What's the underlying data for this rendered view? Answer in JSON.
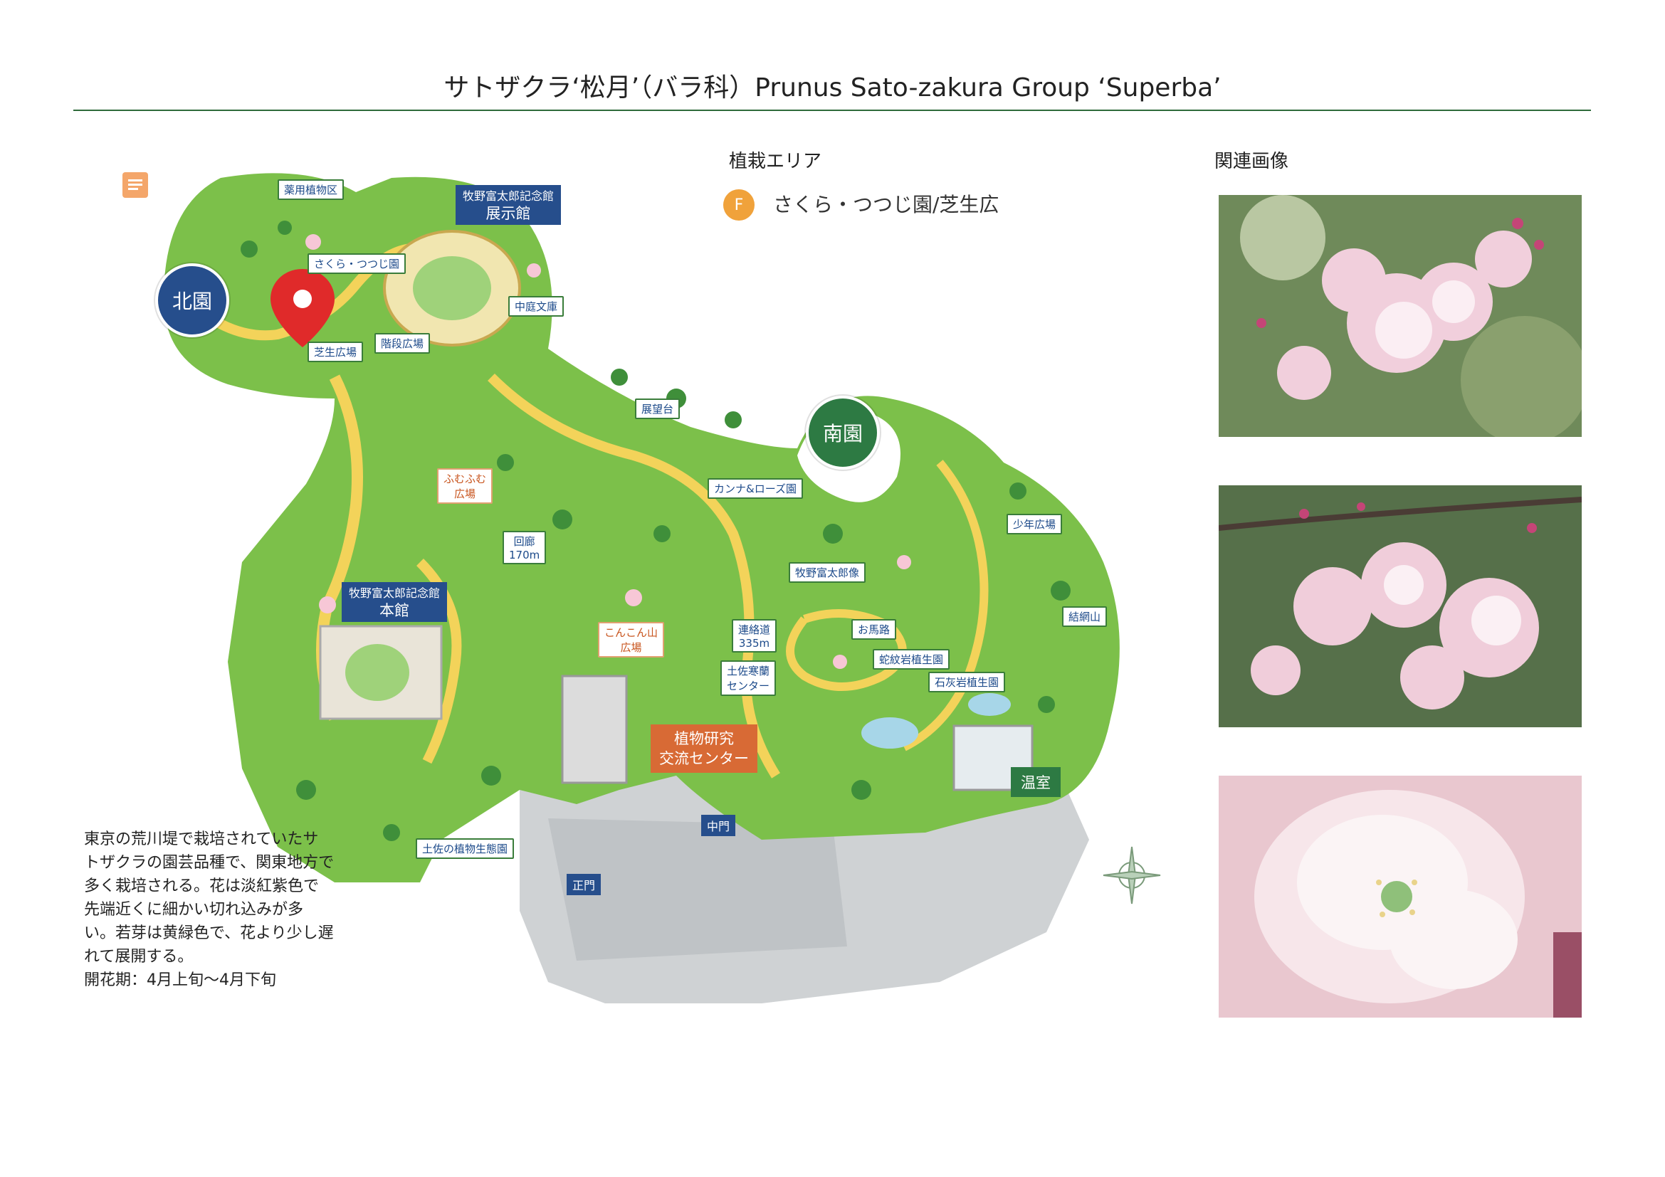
{
  "title": "サトザクラ‘松月’（バラ科）Prunus Sato-zakura Group ‘Superba’",
  "planting": {
    "heading": "植栽エリア",
    "badge_letter": "F",
    "area_name": "さくら・つつじ園/芝生広"
  },
  "photos": {
    "heading": "関連画像"
  },
  "description": {
    "lines": [
      "東京の荒川堤で栽培されていたサ",
      "トザクラの園芸品種で、関東地方で",
      "多く栽培される。花は淡紅紫色で",
      "先端近くに細かい切れ込みが多",
      "い。若芽は黄緑色で、花より少し遅",
      "れて展開する。",
      "開花期：4月上旬〜4月下旬"
    ]
  },
  "map": {
    "zones": {
      "north": "北園",
      "south": "南園"
    },
    "buildings": {
      "exhibit_line1": "牧野富太郎記念館",
      "exhibit_line2": "展示館",
      "main_line1": "牧野富太郎記念館",
      "main_line2": "本館",
      "research_line1": "植物研究",
      "research_line2": "交流センター",
      "greenhouse": "温室"
    },
    "gates": {
      "main": "正門",
      "middle": "中門"
    },
    "labels": {
      "medicinal": "薬用植物区",
      "sakura": "さくら・つつじ園",
      "lawn": "芝生広場",
      "stairs": "階段広場",
      "courtyard": "中庭文庫",
      "observatory": "展望台",
      "canna": "カンナ&ローズ園",
      "fumufumu_1": "ふむふむ",
      "fumufumu_2": "広場",
      "corridor_1": "回廊",
      "corridor_2": "170m",
      "konkon_1": "こんこん山",
      "konkon_2": "広場",
      "renraku_1": "連絡道",
      "renraku_2": "335m",
      "tosa_kanran_1": "土佐寒蘭",
      "tosa_kanran_2": "センター",
      "makino_statue": "牧野富太郎像",
      "ouma": "お馬路",
      "serpentine": "蛇紋岩植生園",
      "limestone": "石灰岩植生園",
      "boys": "少年広場",
      "yuimoyama": "結網山",
      "tosa_ecology": "土佐の植物生態園"
    }
  },
  "colors": {
    "accent_green": "#2d7a43",
    "zone_blue": "#264e8c",
    "badge_orange": "#f0a23b",
    "research_orange": "#d86a35",
    "map_green": "#7cc04a",
    "path_yellow": "#f3d35a"
  }
}
